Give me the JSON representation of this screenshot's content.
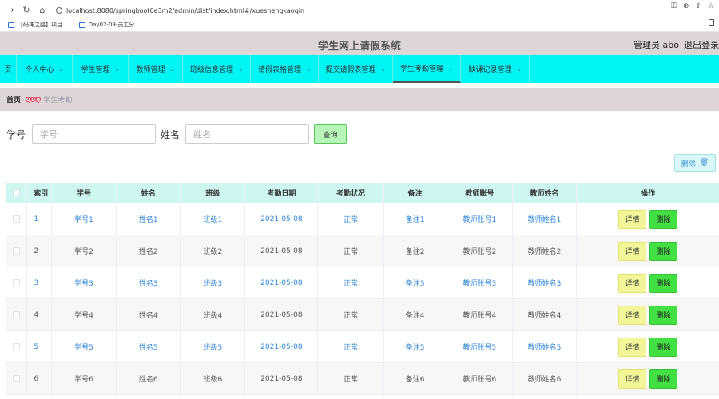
{
  "browser": {
    "url": "localhost:8080/springboot0e3m2/admin/dist/index.html#/xueshengkaoqin",
    "bookmarks": [
      "【码神之路】项目...",
      "Day02-09-员工分..."
    ]
  },
  "header": {
    "title": "学生网上请假系统",
    "user": "管理员 abo",
    "logout": "退出登录"
  },
  "menu": [
    {
      "label": "页"
    },
    {
      "label": "个人中心"
    },
    {
      "label": "学生管理"
    },
    {
      "label": "教师管理"
    },
    {
      "label": "班级信息管理"
    },
    {
      "label": "请假表格管理"
    },
    {
      "label": "提交请假表管理"
    },
    {
      "label": "学生考勤管理"
    },
    {
      "label": "缺课记录管理"
    }
  ],
  "breadcrumb": {
    "home": "首页",
    "sep": "ღღღ",
    "current": "学生考勤"
  },
  "search": {
    "label1": "学号",
    "placeholder1": "学号",
    "label2": "姓名",
    "placeholder2": "姓名",
    "button": "查询"
  },
  "toolbar": {
    "delete_label": "删除"
  },
  "table": {
    "headers": [
      "索引",
      "学号",
      "姓名",
      "班级",
      "考勤日期",
      "考勤状况",
      "备注",
      "教师账号",
      "教师姓名",
      "操作"
    ],
    "rows": [
      [
        "1",
        "学号1",
        "姓名1",
        "班级1",
        "2021-05-08",
        "正常",
        "备注1",
        "教师账号1",
        "教师姓名1"
      ],
      [
        "2",
        "学号2",
        "姓名2",
        "班级2",
        "2021-05-08",
        "正常",
        "备注2",
        "教师账号2",
        "教师姓名2"
      ],
      [
        "3",
        "学号3",
        "姓名3",
        "班级3",
        "2021-05-08",
        "正常",
        "备注3",
        "教师账号3",
        "教师姓名3"
      ],
      [
        "4",
        "学号4",
        "姓名4",
        "班级4",
        "2021-05-08",
        "正常",
        "备注4",
        "教师账号4",
        "教师姓名4"
      ],
      [
        "5",
        "学号5",
        "姓名5",
        "班级5",
        "2021-05-08",
        "正常",
        "备注5",
        "教师账号5",
        "教师姓名5"
      ],
      [
        "6",
        "学号6",
        "姓名6",
        "班级6",
        "2021-05-08",
        "正常",
        "备注6",
        "教师账号6",
        "教师姓名6"
      ]
    ],
    "detail_label": "详情",
    "row_delete_label": "删除"
  }
}
